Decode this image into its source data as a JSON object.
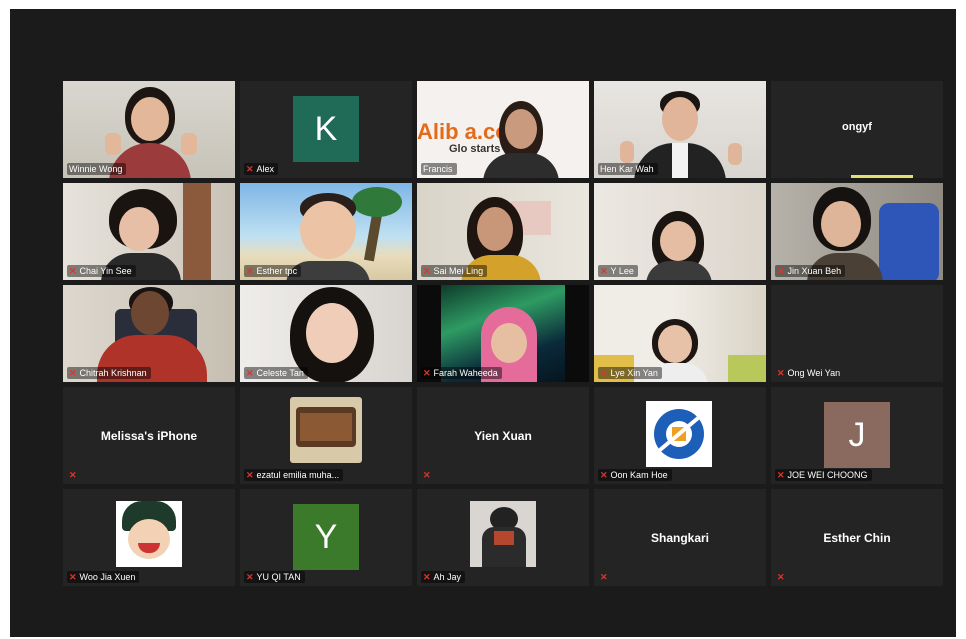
{
  "meeting": {
    "participants": [
      {
        "name": "Winnie Wong",
        "display": "",
        "muted": false,
        "active": true
      },
      {
        "name": "Alex",
        "display": "K",
        "muted": true,
        "avatar_color": "#1f6b57"
      },
      {
        "name": "Francis",
        "display": "",
        "muted": false,
        "banner_text": "Alib       a.co",
        "banner_sub": "Glo        starts"
      },
      {
        "name": "Hen Kar Wah",
        "display": "",
        "muted": false
      },
      {
        "name": "",
        "display": "ongyf",
        "muted": false,
        "speaking": true
      },
      {
        "name": "Chai Yin See",
        "display": "",
        "muted": true
      },
      {
        "name": "Esther tpc",
        "display": "",
        "muted": true
      },
      {
        "name": "Sai Mei Ling",
        "display": "",
        "muted": true
      },
      {
        "name": "Y Lee",
        "display": "",
        "muted": true
      },
      {
        "name": "Jin Xuan Beh",
        "display": "",
        "muted": true
      },
      {
        "name": "Chitrah Krishnan",
        "display": "",
        "muted": true
      },
      {
        "name": "Celeste Tan",
        "display": "",
        "muted": true
      },
      {
        "name": "Farah Waheeda",
        "display": "",
        "muted": true
      },
      {
        "name": "Lye Xin Yan",
        "display": "",
        "muted": true
      },
      {
        "name": "Ong Wei Yan",
        "display": "",
        "muted": true
      },
      {
        "name": "",
        "display": "Melissa's iPhone",
        "muted": true
      },
      {
        "name": "ezatul emilia muha...",
        "display": "",
        "muted": true
      },
      {
        "name": "",
        "display": "Yien Xuan",
        "muted": true
      },
      {
        "name": "Oon Kam Hoe",
        "display": "",
        "muted": true
      },
      {
        "name": "JOE WEI CHOONG",
        "display": "J",
        "muted": true,
        "avatar_color": "#8a6a5e"
      },
      {
        "name": "Woo Jia Xuen",
        "display": "",
        "muted": true
      },
      {
        "name": "YU QI TAN",
        "display": "Y",
        "muted": true,
        "avatar_color": "#3a7a2a"
      },
      {
        "name": "Ah Jay",
        "display": "",
        "muted": true
      },
      {
        "name": "",
        "display": "Shangkari",
        "muted": true
      },
      {
        "name": "",
        "display": "Esther Chin",
        "muted": true
      }
    ]
  }
}
